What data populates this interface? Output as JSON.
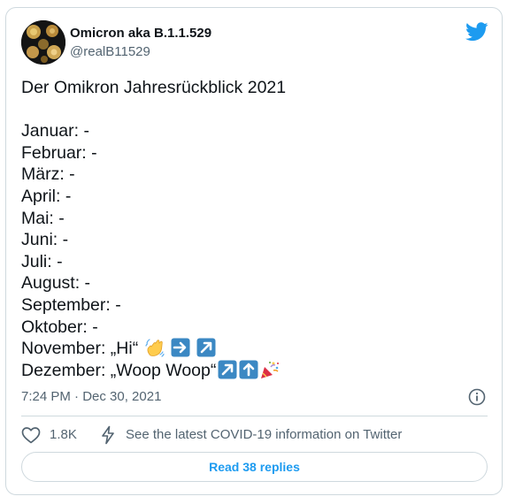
{
  "user": {
    "display_name": "Omicron aka B.1.1.529",
    "handle": "@realB11529"
  },
  "tweet": {
    "title_line": "Der Omikron Jahresrückblick 2021",
    "lines": [
      "Januar: -",
      "Februar: -",
      "März: -",
      "April: -",
      "Mai: -",
      "Juni: -",
      "Juli: -",
      "August: -",
      "September: -",
      "Oktober: -"
    ],
    "november_text": "November: „Hi“",
    "dezember_text": "Dezember: „Woop Woop“",
    "november_emojis": [
      "waving-hand-emoji",
      "right-arrow-emoji",
      "up-right-arrow-emoji"
    ],
    "dezember_emojis": [
      "up-right-arrow-emoji",
      "up-arrow-emoji",
      "party-popper-emoji"
    ]
  },
  "meta": {
    "timestamp": "7:24 PM · Dec 30, 2021"
  },
  "actions": {
    "like_count": "1.8K",
    "covid_info": "See the latest COVID-19 information on Twitter",
    "read_replies": "Read 38 replies"
  },
  "colors": {
    "twitter_blue": "#1d9bf0",
    "text_primary": "#0f1419",
    "text_secondary": "#536471",
    "border": "#cfd9de",
    "emoji_arrow_blue": "#3b88c3"
  }
}
